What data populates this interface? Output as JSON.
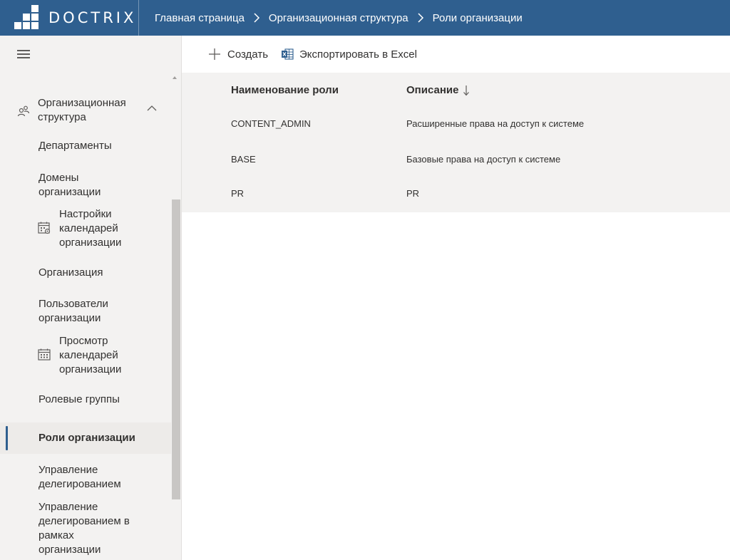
{
  "header": {
    "logo_text": "DOCTRIX",
    "breadcrumbs": [
      {
        "label": "Главная страница"
      },
      {
        "label": "Организационная структура"
      },
      {
        "label": "Роли организации"
      }
    ],
    "colors": {
      "bar": "#2f5f8f"
    }
  },
  "sidebar": {
    "menu_icon": "hamburger-icon",
    "group": {
      "label": "Организационная структура",
      "icon": "people-icon",
      "expanded": true
    },
    "items": [
      {
        "label": "Департаменты"
      },
      {
        "label": "Домены организации"
      },
      {
        "label": "Настройки календарей организации",
        "icon": "calendar-settings-icon"
      },
      {
        "label": "Организация"
      },
      {
        "label": "Пользователи организации"
      },
      {
        "label": "Просмотр календарей организации",
        "icon": "calendar-icon"
      },
      {
        "label": "Ролевые группы"
      },
      {
        "label": "Роли организации",
        "active": true
      },
      {
        "label": "Управление делегированием"
      },
      {
        "label": "Управление делегированием в рамках организации"
      }
    ]
  },
  "toolbar": {
    "create_label": "Создать",
    "export_label": "Экспортировать в Excel"
  },
  "table": {
    "columns": [
      {
        "label": "Наименование роли"
      },
      {
        "label": "Описание",
        "sort": "descending"
      }
    ],
    "rows": [
      {
        "name": "CONTENT_ADMIN",
        "description": "Расширенные права на доступ к системе"
      },
      {
        "name": "BASE",
        "description": "Базовые права на доступ к системе"
      },
      {
        "name": "PR",
        "description": "PR"
      }
    ]
  }
}
